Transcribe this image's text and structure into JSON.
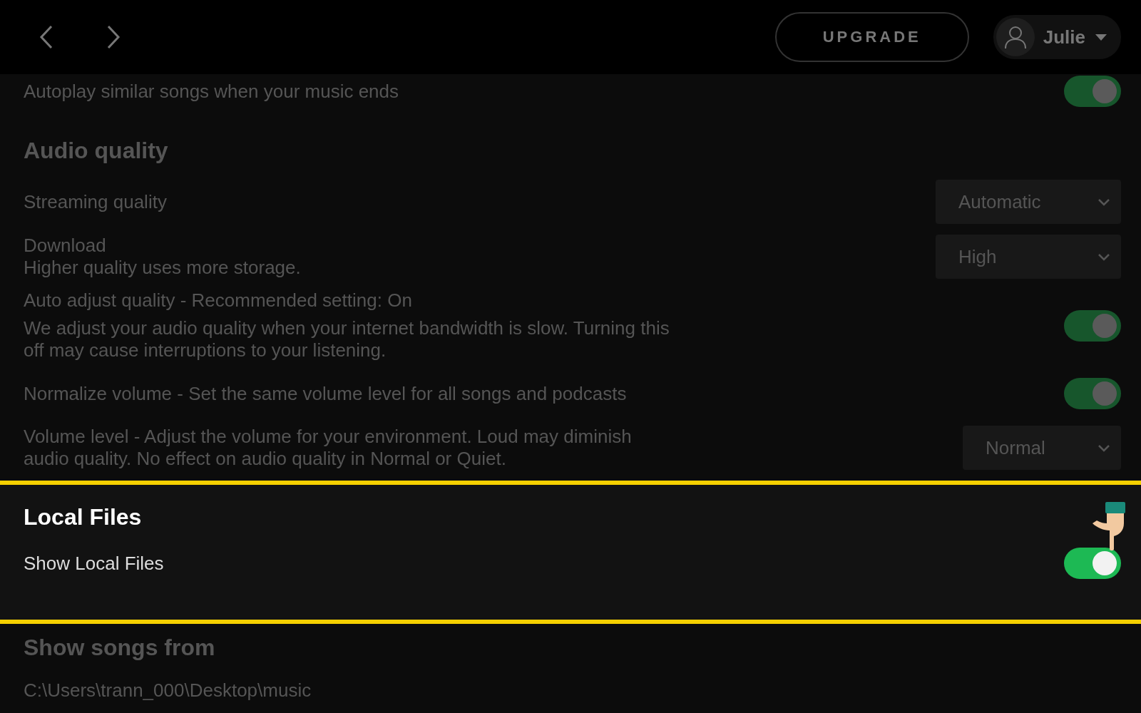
{
  "topbar": {
    "upgrade": "UPGRADE",
    "user": "Julie"
  },
  "partial_row": {
    "label": "Autoplay similar songs when your music ends",
    "on": true
  },
  "sections": [
    {
      "title": "Audio quality",
      "highlighted": false,
      "rows": [
        {
          "kind": "select",
          "label": "Streaming quality",
          "value": "Automatic"
        },
        {
          "kind": "select",
          "label": "Download",
          "description": "Higher quality uses more storage.",
          "value": "High"
        },
        {
          "kind": "toggle",
          "label": "Auto adjust quality - Recommended setting: On",
          "description": "We adjust your audio quality when your internet bandwidth is slow. Turning this off may cause interruptions to your listening.",
          "on": true
        },
        {
          "kind": "toggle",
          "label": "Normalize volume - Set the same volume level for all songs and podcasts",
          "on": true
        },
        {
          "kind": "select",
          "label": "Volume level - Adjust the volume for your environment. Loud may diminish audio quality. No effect on audio quality in Normal or Quiet.",
          "value": "Normal"
        }
      ]
    },
    {
      "title": "Local Files",
      "highlighted": true,
      "rows": [
        {
          "kind": "toggle",
          "label": "Show Local Files",
          "on": true,
          "pointer": true
        }
      ]
    },
    {
      "title": "Show songs from",
      "highlighted": false,
      "rows": [
        {
          "kind": "path",
          "label": "C:\\Users\\trann_000\\Desktop\\music"
        }
      ]
    }
  ]
}
